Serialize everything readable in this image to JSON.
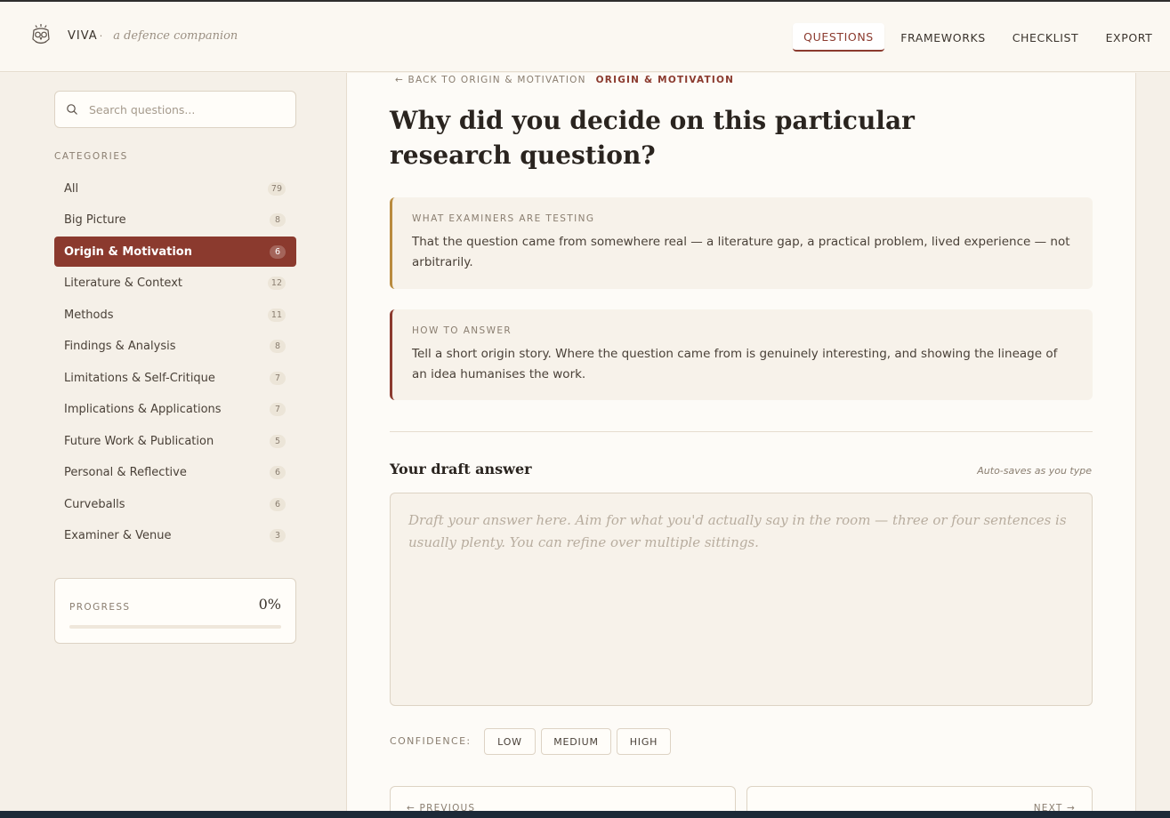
{
  "app": {
    "name": "VIVA",
    "dot": "·",
    "tagline": "a defence companion"
  },
  "nav": {
    "items": [
      {
        "label": "QUESTIONS",
        "active": true
      },
      {
        "label": "FRAMEWORKS",
        "active": false
      },
      {
        "label": "CHECKLIST",
        "active": false
      },
      {
        "label": "EXPORT",
        "active": false
      }
    ]
  },
  "sidebar": {
    "search_placeholder": "Search questions...",
    "categories_heading": "CATEGORIES",
    "categories": [
      {
        "label": "All",
        "count": "79"
      },
      {
        "label": "Big Picture",
        "count": "8"
      },
      {
        "label": "Origin & Motivation",
        "count": "6",
        "active": true
      },
      {
        "label": "Literature & Context",
        "count": "12"
      },
      {
        "label": "Methods",
        "count": "11"
      },
      {
        "label": "Findings & Analysis",
        "count": "8"
      },
      {
        "label": "Limitations & Self-Critique",
        "count": "7"
      },
      {
        "label": "Implications & Applications",
        "count": "7"
      },
      {
        "label": "Future Work & Publication",
        "count": "5"
      },
      {
        "label": "Personal & Reflective",
        "count": "6"
      },
      {
        "label": "Curveballs",
        "count": "6"
      },
      {
        "label": "Examiner & Venue",
        "count": "3"
      }
    ],
    "progress": {
      "label": "PROGRESS",
      "value": "0%",
      "fraction": 0
    }
  },
  "main": {
    "back_link": "← BACK TO ORIGIN & MOTIVATION",
    "current_category": "ORIGIN & MOTIVATION",
    "question": "Why did you decide on this particular research question?",
    "testing": {
      "heading": "WHAT EXAMINERS ARE TESTING",
      "text": "That the question came from somewhere real — a literature gap, a practical problem, lived experience — not arbitrarily."
    },
    "how_to": {
      "heading": "HOW TO ANSWER",
      "text": "Tell a short origin story. Where the question came from is genuinely interesting, and showing the lineage of an idea humanises the work."
    },
    "draft": {
      "title": "Your draft answer",
      "autosave_note": "Auto-saves as you type",
      "placeholder": "Draft your answer here. Aim for what you'd actually say in the room — three or four sentences is usually plenty. You can refine over multiple sittings.",
      "value": ""
    },
    "confidence": {
      "label": "CONFIDENCE:",
      "options": [
        "LOW",
        "MEDIUM",
        "HIGH"
      ]
    },
    "pager": {
      "previous": "← PREVIOUS",
      "next": "NEXT →"
    }
  },
  "colors": {
    "accent": "#8b3a2e",
    "testing_bar": "#b98b3e",
    "background": "#f6f1e9"
  }
}
